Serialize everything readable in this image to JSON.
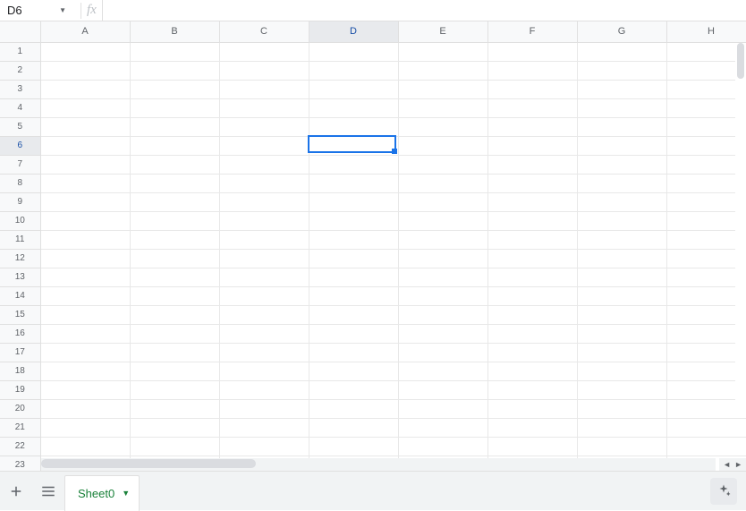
{
  "name_box": {
    "value": "D6"
  },
  "formula_bar": {
    "fx_label": "fx",
    "value": ""
  },
  "columns": [
    "A",
    "B",
    "C",
    "D",
    "E",
    "F",
    "G",
    "H"
  ],
  "rows": [
    "1",
    "2",
    "3",
    "4",
    "5",
    "6",
    "7",
    "8",
    "9",
    "10",
    "11",
    "12",
    "13",
    "14",
    "15",
    "16",
    "17",
    "18",
    "19",
    "20",
    "21",
    "22",
    "23"
  ],
  "selected": {
    "col": "D",
    "row": "6",
    "col_index": 3,
    "row_index": 5
  },
  "sheet_tabs": {
    "active": "Sheet0"
  },
  "cells": {}
}
